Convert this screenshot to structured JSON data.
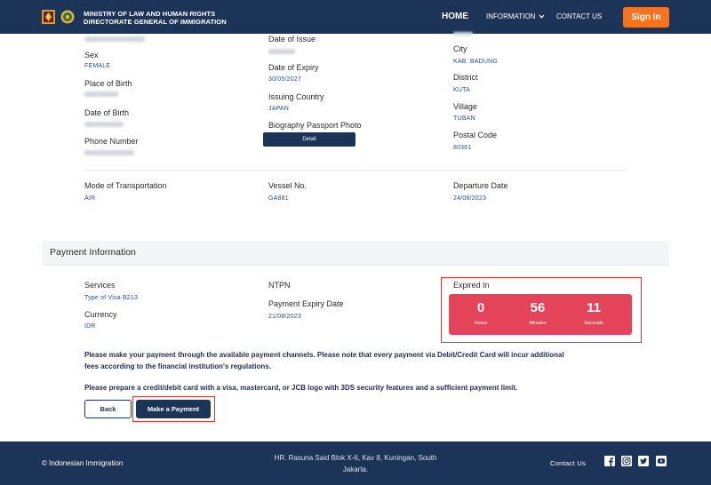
{
  "header": {
    "brand_line1": "MINISTRY OF LAW AND HUMAN RIGHTS",
    "brand_line2": "DIRECTORATE GENERAL OF IMMIGRATION",
    "nav": {
      "home": "HOME",
      "information": "INFORMATION",
      "contact": "CONTACT US",
      "signin": "Sign In"
    }
  },
  "details": {
    "col1": {
      "sex_label": "Sex",
      "sex_value": "FEMALE",
      "place_of_birth_label": "Place of Birth",
      "date_of_birth_label": "Date of Birth",
      "phone_label": "Phone Number"
    },
    "col2": {
      "date_of_issue_label": "Date of Issue",
      "date_of_expiry_label": "Date of Expiry",
      "date_of_expiry_value": "30/05/2027",
      "issuing_country_label": "Issuing Country",
      "issuing_country_value": "JAPAN",
      "photo_label": "Biography Passport Photo",
      "detail_button": "Detail"
    },
    "col3": {
      "city_label": "City",
      "city_value": "KAB. BADUNG",
      "district_label": "District",
      "district_value": "KUTA",
      "village_label": "Village",
      "village_value": "TUBAN",
      "postal_label": "Postal Code",
      "postal_value": "80361"
    },
    "travel": {
      "mode_label": "Mode of Transportation",
      "mode_value": "AIR",
      "vessel_label": "Vessel No.",
      "vessel_value": "GA881",
      "departure_label": "Departure Date",
      "departure_value": "24/08/2023"
    }
  },
  "payment": {
    "title": "Payment Information",
    "services_label": "Services",
    "services_value": "Type of Visa B213",
    "currency_label": "Currency",
    "currency_value": "IDR",
    "ntpn_label": "NTPN",
    "expiry_label": "Payment Expiry Date",
    "expiry_value": "21/08/2023",
    "expired_in_label": "Expired In",
    "countdown": {
      "hours": "0",
      "hours_label": "Hours",
      "minutes": "56",
      "minutes_label": "Minutes",
      "seconds": "11",
      "seconds_label": "Seconds"
    },
    "note1_line1": "Please make your payment through the available payment channels. Please note that every payment via Debit/Credit Card will incur additional",
    "note1_line2": "fees according to the financial institution's regulations.",
    "note2": "Please prepare a credit/debit card with a visa, mastercard, or JCB logo with 3DS security features and a sufficient payment limit.",
    "back_button": "Back",
    "pay_button": "Make a Payment"
  },
  "footer": {
    "copyright": "© Indonesian Immigration",
    "address_line1": "HR. Rasuna Said Blok X-6, Kav 8, Kuningan, South",
    "address_line2": "Jakarta.",
    "contact": "Contact Us",
    "social_icons": [
      "facebook-icon",
      "instagram-icon",
      "twitter-icon",
      "youtube-icon"
    ]
  },
  "colors": {
    "navy": "#1c3457",
    "orange": "#f47421",
    "countdown_red": "#e5435a",
    "highlight_red": "#e5332a",
    "value_blue": "#2a4e86"
  }
}
